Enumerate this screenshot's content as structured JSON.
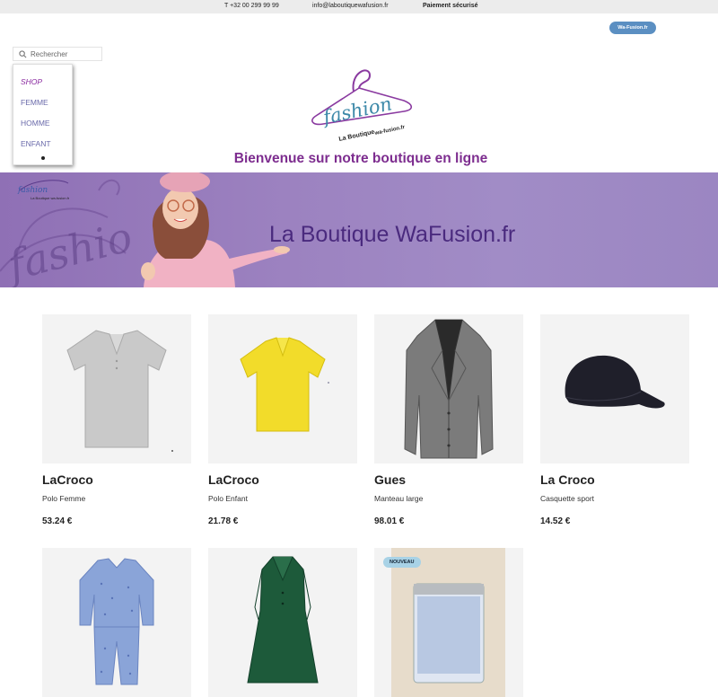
{
  "topbar": {
    "phone": "T +32 00 299 99 99",
    "email": "info@laboutiquewafusion.fr",
    "secure": "Paiement sécurisé"
  },
  "site_button": "Wa-Fusion.fr",
  "search": {
    "placeholder": "Rechercher"
  },
  "menu": {
    "items": [
      {
        "label": "SHOP"
      },
      {
        "label": "FEMME"
      },
      {
        "label": "HOMME"
      },
      {
        "label": "ENFANT"
      }
    ]
  },
  "logo": {
    "word": "fashion",
    "line1": "La Boutique",
    "line2": "wa-fusion.fr"
  },
  "welcome": "Bienvenue sur notre boutique en ligne",
  "banner": {
    "title": "La Boutique WaFusion.fr"
  },
  "products": [
    {
      "brand": "LaCroco",
      "desc": "Polo Femme",
      "price": "53.24 €",
      "icon": "grey-polo-shirt"
    },
    {
      "brand": "LaCroco",
      "desc": "Polo Enfant",
      "price": "21.78 €",
      "icon": "yellow-polo-shirt"
    },
    {
      "brand": "Gues",
      "desc": "Manteau large",
      "price": "98.01 €",
      "icon": "grey-coat"
    },
    {
      "brand": "La Croco",
      "desc": "Casquette sport",
      "price": "14.52 €",
      "icon": "black-cap"
    },
    {
      "icon": "blue-pyjamas"
    },
    {
      "icon": "green-coat"
    },
    {
      "badge": "NOUVEAU",
      "icon": "candle-jar"
    }
  ],
  "colors": {
    "accent": "#7d2d8f",
    "banner": "#9c82c0",
    "button": "#5b8fc2"
  }
}
